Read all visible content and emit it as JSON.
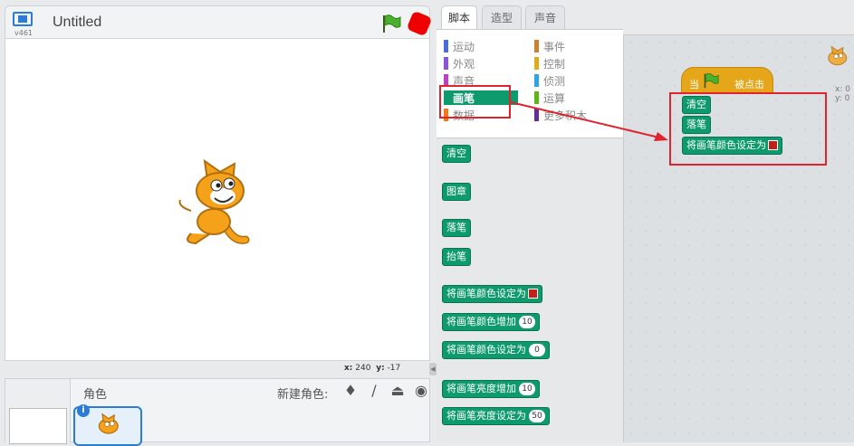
{
  "stage": {
    "version": "v461",
    "title": "Untitled",
    "coords": {
      "x_label": "x:",
      "x_value": "240",
      "y_label": "y:",
      "y_value": "-17"
    }
  },
  "sprites": {
    "label": "角色",
    "new_sprite_label": "新建角色:"
  },
  "tabs": [
    "脚本",
    "造型",
    "声音"
  ],
  "categories": [
    {
      "label": "运动",
      "color": "#4a6cd4"
    },
    {
      "label": "事件",
      "color": "#c88330"
    },
    {
      "label": "外观",
      "color": "#8a55d7"
    },
    {
      "label": "控制",
      "color": "#e1a91a"
    },
    {
      "label": "声音",
      "color": "#bb42c3"
    },
    {
      "label": "侦测",
      "color": "#2ca5e2"
    },
    {
      "label": "画笔",
      "color": "#0e9a6c"
    },
    {
      "label": "运算",
      "color": "#5cb712"
    },
    {
      "label": "数据",
      "color": "#ee7d16"
    },
    {
      "label": "更多积木",
      "color": "#632d99"
    }
  ],
  "palette_blocks": {
    "clear": "清空",
    "stamp": "图章",
    "pen_down": "落笔",
    "pen_up": "抬笔",
    "set_color": "将画笔颜色设定为",
    "change_color": "将画笔颜色增加",
    "change_color_value": "10",
    "set_color_num": "将画笔颜色设定为",
    "set_color_num_value": "0",
    "change_shade": "将画笔亮度增加",
    "change_shade_value": "10",
    "set_shade": "将画笔亮度设定为",
    "set_shade_value": "50"
  },
  "script": {
    "hat_when": "当",
    "hat_clicked": "被点击",
    "clear": "清空",
    "pen_down": "落笔",
    "set_color": "将画笔颜色设定为"
  },
  "mini_coords": {
    "x": "x: 0",
    "y": "y: 0"
  },
  "colors": {
    "pen_green": "#0e9a6c",
    "highlight_red": "#e0242e",
    "event_orange": "#e6a619",
    "swatch": "#c0221a"
  }
}
